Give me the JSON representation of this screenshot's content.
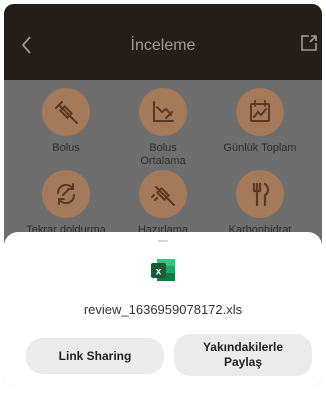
{
  "header": {
    "title": "İnceleme",
    "back_icon": "chevron-left-icon",
    "share_icon": "share-external-icon"
  },
  "colors": {
    "header_bg": "#251d17",
    "icon_circle": "#a57a5a",
    "overlay_bg": "#6e6e6e",
    "xls_green": "#1f8a4c"
  },
  "tiles": [
    {
      "label": "Bolus",
      "icon": "syringe-icon"
    },
    {
      "label": "Bolus Ortalama",
      "icon": "chart-average-icon"
    },
    {
      "label": "Günlük Toplam",
      "icon": "calendar-chart-icon"
    },
    {
      "label": "Tekrar doldurma",
      "icon": "refill-icon"
    },
    {
      "label": "Hazırlama",
      "icon": "prime-syringe-icon"
    },
    {
      "label": "Karbonhidrat",
      "icon": "fork-knife-icon"
    }
  ],
  "sheet": {
    "file_icon": "excel-file-icon",
    "file_letter": "x",
    "filename": "review_1636959078172.xls",
    "link_sharing_label": "Link Sharing",
    "nearby_share_label": "Yakındakilerle Paylaş"
  }
}
